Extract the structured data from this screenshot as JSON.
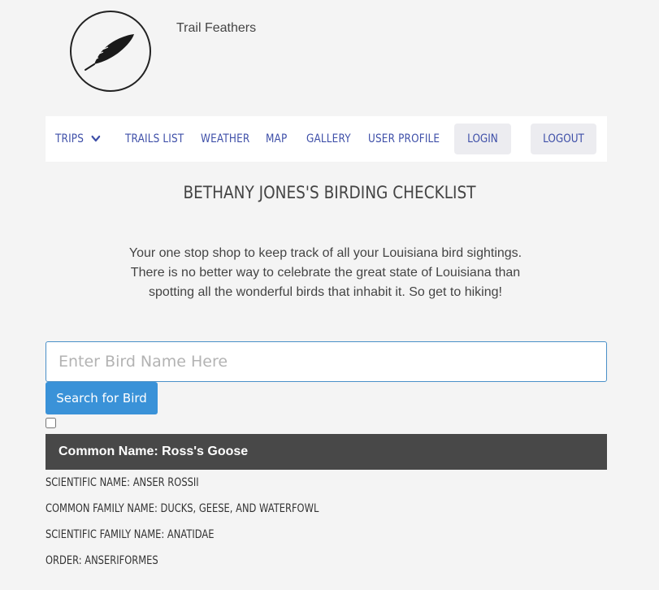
{
  "site": {
    "name": "Trail Feathers",
    "logo_icon": "feather-icon"
  },
  "nav": {
    "items": [
      {
        "label": "TRIPS",
        "has_dropdown": true
      },
      {
        "label": "TRAILS LIST"
      },
      {
        "label": "WEATHER"
      },
      {
        "label": "MAP"
      },
      {
        "label": "GALLERY"
      },
      {
        "label": "USER PROFILE"
      }
    ],
    "login_label": "LOGIN",
    "logout_label": "LOGOUT",
    "link_color": "#3e4fa8"
  },
  "page": {
    "title": "BETHANY JONES'S BIRDING CHECKLIST",
    "intro_lines": [
      "Your one stop shop to keep track of all your Louisiana bird sightings.",
      "There is no better way to celebrate the great state of Louisiana than",
      "spotting all the wonderful birds that inhabit it. So get to hiking!"
    ]
  },
  "search": {
    "placeholder": "Enter Bird Name Here",
    "value": "",
    "button_label": "Search for Bird",
    "button_color": "#3a92d8"
  },
  "bird": {
    "checked": false,
    "header": "Common Name: Ross's Goose",
    "header_bg": "#484848",
    "details": [
      "SCIENTIFIC NAME: ANSER ROSSII",
      "COMMON FAMILY NAME: DUCKS, GEESE, AND WATERFOWL",
      "SCIENTIFIC FAMILY NAME: ANATIDAE",
      "ORDER: ANSERIFORMES"
    ]
  }
}
